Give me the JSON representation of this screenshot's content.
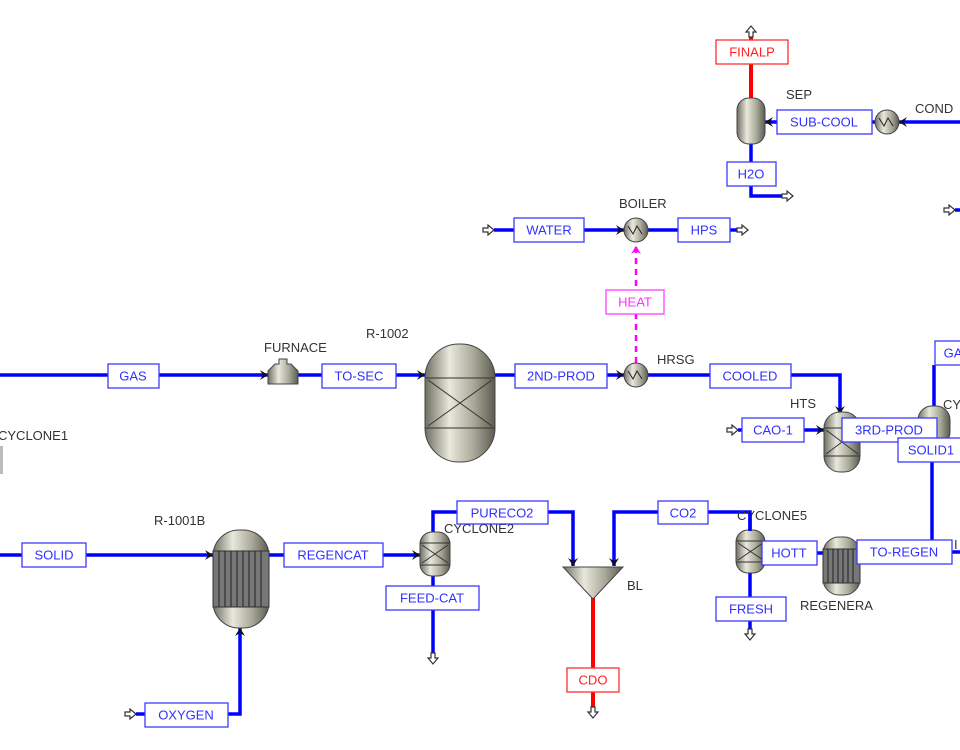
{
  "colors": {
    "material_stream": "#0000ff",
    "hot_stream": "#ff0000",
    "heat_stream": "#ff00ff",
    "equipment": "#a8a898"
  },
  "streams": {
    "finalp": "FINALP",
    "sub_cool": "SUB-COOL",
    "h2o": "H2O",
    "water": "WATER",
    "hps": "HPS",
    "heat": "HEAT",
    "gas": "GAS",
    "to_sec": "TO-SEC",
    "2nd_prod": "2ND-PROD",
    "cooled": "COOLED",
    "cao_1": "CAO-1",
    "3rd_prod": "3RD-PROD",
    "ga": "GA",
    "solid1": "SOLID1",
    "solid": "SOLID",
    "regencat": "REGENCAT",
    "pureco2": "PURECO2",
    "feed_cat": "FEED-CAT",
    "co2": "CO2",
    "cdo": "CDO",
    "hott": "HOTT",
    "fresh": "FRESH",
    "to_regen": "TO-REGEN",
    "oxygen": "OXYGEN"
  },
  "blocks": {
    "sep": "SEP",
    "cond": "COND",
    "boiler": "BOILER",
    "furnace": "FURNACE",
    "r1002": "R-1002",
    "hrsg": "HRSG",
    "hts": "HTS",
    "cy": "CY",
    "cyclone1": "CYCLONE1",
    "r1001b": "R-1001B",
    "cyclone2": "CYCLONE2",
    "bl": "BL",
    "cyclone5": "CYCLONE5",
    "regenera": "REGENERA",
    "edge_label": "I"
  }
}
